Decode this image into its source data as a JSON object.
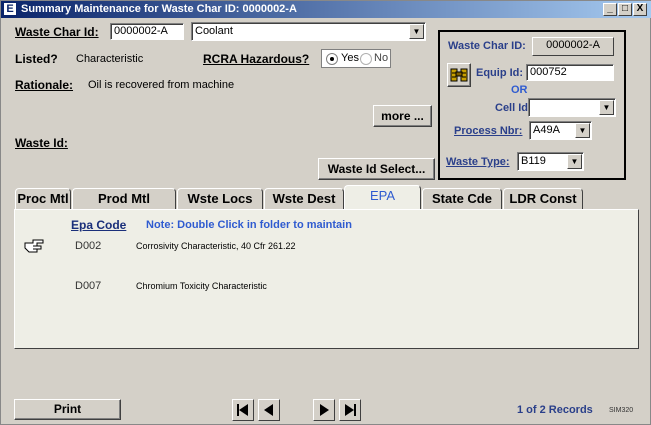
{
  "window": {
    "title": "Summary Maintenance for Waste Char ID: 0000002-A",
    "app_icon": "E",
    "minimize_label": "_",
    "maximize_label": "□",
    "close_label": "X"
  },
  "form": {
    "waste_char_id_label": "Waste Char Id:",
    "waste_char_id_value": "0000002-A",
    "description_value": "Coolant",
    "listed_label": "Listed?",
    "listed_value": "Characteristic",
    "rcra_label": "RCRA Hazardous?",
    "rcra_yes_label": "Yes",
    "rcra_no_label": "No",
    "rcra_selected": "Yes",
    "rationale_label": "Rationale:",
    "rationale_value": "Oil is recovered from machine",
    "more_button": "more ...",
    "waste_id_label": "Waste Id:",
    "waste_id_select_button": "Waste Id Select..."
  },
  "panel": {
    "waste_char_id_label": "Waste Char ID:",
    "waste_char_id_value": "0000002-A",
    "equip_id_label": "Equip Id:",
    "equip_id_value": "000752",
    "or_label": "OR",
    "cell_id_label": "Cell Id:",
    "cell_id_value": "",
    "process_nbr_label": "Process Nbr:",
    "process_nbr_value": "A49A",
    "waste_type_label": "Waste Type:",
    "waste_type_value": "B119",
    "equipment_icon": "binoculars-icon"
  },
  "tabs": [
    {
      "label": "Proc Mtl"
    },
    {
      "label": "Prod Mtl"
    },
    {
      "label": "Wste Locs"
    },
    {
      "label": "Wste Dest"
    },
    {
      "label": "EPA"
    },
    {
      "label": "State Cde"
    },
    {
      "label": "LDR Const"
    }
  ],
  "active_tab": "EPA",
  "epa": {
    "column_header": "Epa Code",
    "note": "Note: Double Click in folder to maintain",
    "pointer_icon": "pointing-hand-icon",
    "rows": [
      {
        "code": "D002",
        "description": "Corrosivity Characteristic, 40 Cfr 261.22"
      },
      {
        "code": "D007",
        "description": "Chromium Toxicity Characteristic"
      }
    ]
  },
  "footer": {
    "print_button": "Print",
    "record_status": "1 of 2 Records",
    "screen_code": "SIM320",
    "nav_icons": [
      "first-record-icon",
      "previous-record-icon",
      "next-record-icon",
      "last-record-icon"
    ]
  },
  "colors": {
    "title_start": "#0a246a",
    "title_end": "#a6caf0",
    "accent_blue": "#2f5bd0",
    "panel_bg": "#eeeee6"
  }
}
